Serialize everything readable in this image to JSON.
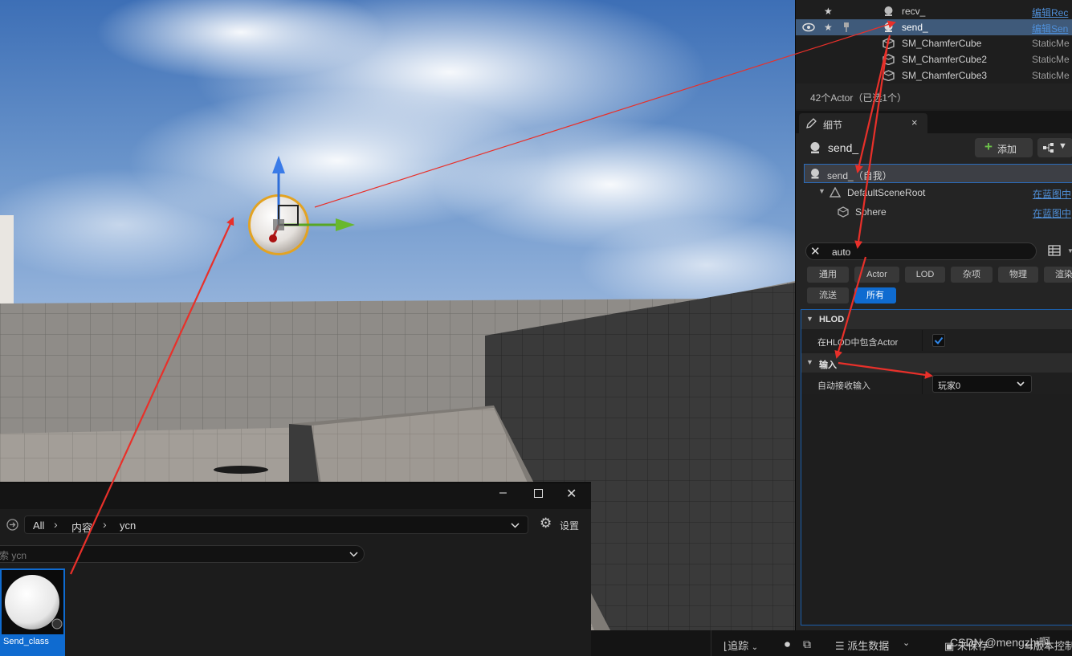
{
  "outliner": {
    "rows": [
      {
        "name": "recv_",
        "type": "编辑Rec",
        "type_link": true,
        "star": "★"
      },
      {
        "name": "send_",
        "type": "编辑Sen",
        "type_link": true,
        "star": "★",
        "selected": true
      },
      {
        "name": "SM_ChamferCube",
        "type": "StaticMe",
        "type_link": false
      },
      {
        "name": "SM_ChamferCube2",
        "type": "StaticMe",
        "type_link": false
      },
      {
        "name": "SM_ChamferCube3",
        "type": "StaticMe",
        "type_link": false
      }
    ],
    "footer": "42个Actor（已选1个）"
  },
  "details": {
    "tab_label": "细节",
    "tab_close": "×",
    "actor_name": "send_",
    "add_label": "添加",
    "components": [
      {
        "name": "send_（自我）",
        "link": ""
      },
      {
        "name": "DefaultSceneRoot",
        "link": "在蓝图中"
      },
      {
        "name": "Sphere",
        "link": "在蓝图中"
      }
    ],
    "search_value": "auto",
    "filters_row1": [
      "通用",
      "Actor",
      "LOD",
      "杂项",
      "物理",
      "渲染"
    ],
    "filters_row2": [
      "流送",
      "所有"
    ],
    "active_filter": "所有",
    "sections": [
      {
        "title": "HLOD",
        "prop_label": "在HLOD中包含Actor",
        "checked": true
      },
      {
        "title": "输入",
        "prop_label": "自动接收输入",
        "value": "玩家0"
      }
    ]
  },
  "content_browser": {
    "path": [
      "All",
      "内容",
      "ycn"
    ],
    "settings_label": "设置",
    "search_placeholder": "索 ycn",
    "asset_label": "Send_class"
  },
  "statusbar": {
    "trace_label": "追踪",
    "derived_data_label": "派生数据",
    "save_label": "未保存",
    "source_control_label": "版本控制"
  },
  "watermark": "CSDN @mengzhi啊",
  "colors": {
    "accent": "#0f6bd0",
    "selection": "#3f5a7a",
    "link": "#4f8fd8",
    "annotation_arrow": "#e8302a"
  }
}
